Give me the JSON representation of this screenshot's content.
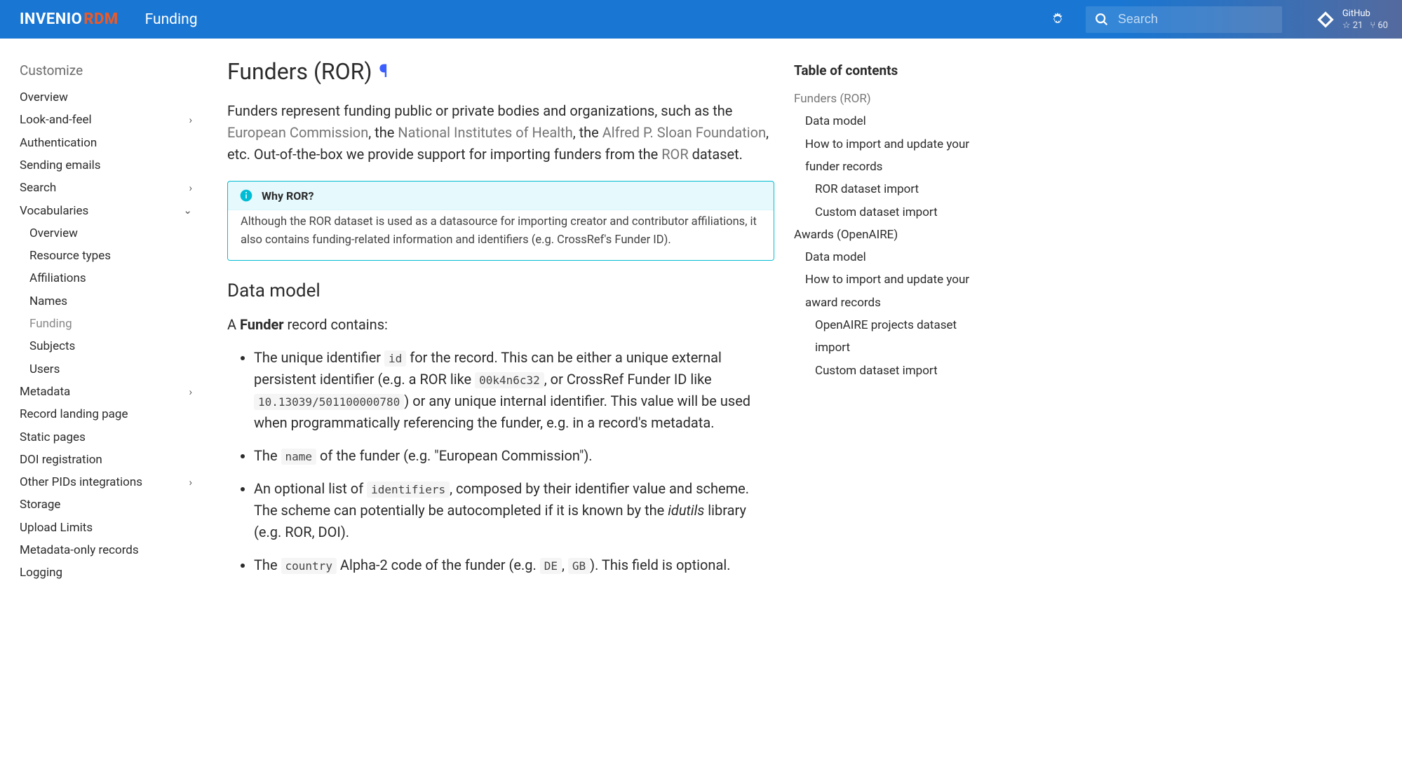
{
  "header": {
    "logo_invenio": "INVENIO",
    "logo_rdm": "RDM",
    "page_title": "Funding",
    "search_placeholder": "Search",
    "github_label": "GitHub",
    "github_stars": "21",
    "github_forks": "60"
  },
  "sidebar": {
    "section_title": "Customize",
    "items": [
      {
        "label": "Overview",
        "chev": false
      },
      {
        "label": "Look-and-feel",
        "chev": true
      },
      {
        "label": "Authentication",
        "chev": false
      },
      {
        "label": "Sending emails",
        "chev": false
      },
      {
        "label": "Search",
        "chev": true
      },
      {
        "label": "Vocabularies",
        "chev": true,
        "open": true
      },
      {
        "label": "Overview",
        "sub": true
      },
      {
        "label": "Resource types",
        "sub": true
      },
      {
        "label": "Affiliations",
        "sub": true
      },
      {
        "label": "Names",
        "sub": true
      },
      {
        "label": "Funding",
        "sub": true,
        "active": true
      },
      {
        "label": "Subjects",
        "sub": true
      },
      {
        "label": "Users",
        "sub": true
      },
      {
        "label": "Metadata",
        "chev": true
      },
      {
        "label": "Record landing page",
        "chev": false
      },
      {
        "label": "Static pages",
        "chev": false
      },
      {
        "label": "DOI registration",
        "chev": false
      },
      {
        "label": "Other PIDs integrations",
        "chev": true
      },
      {
        "label": "Storage",
        "chev": false
      },
      {
        "label": "Upload Limits",
        "chev": false
      },
      {
        "label": "Metadata-only records",
        "chev": false
      },
      {
        "label": "Logging",
        "chev": false
      }
    ]
  },
  "content": {
    "h1": "Funders (ROR)",
    "intro_1": "Funders represent funding public or private bodies and organizations, such as the ",
    "link_ec": "European Commission",
    "intro_2": ", the ",
    "link_nih": "National Institutes of Health",
    "intro_3": ", the ",
    "link_sloan": "Alfred P. Sloan Foundation",
    "intro_4": ", etc. Out-of-the-box we provide support for importing funders from the ",
    "link_ror": "ROR",
    "intro_5": " dataset.",
    "adm_title": "Why ROR?",
    "adm_body": "Although the ROR dataset is used as a datasource for importing creator and contributor affiliations, it also contains funding-related information and identifiers (e.g. CrossRef's Funder ID).",
    "h2": "Data model",
    "p_contains_1": "A ",
    "p_contains_bold": "Funder",
    "p_contains_2": " record contains:",
    "li1_a": "The unique identifier ",
    "li1_code1": "id",
    "li1_b": " for the record. This can be either a unique external persistent identifier (e.g. a ROR like ",
    "li1_code2": "00k4n6c32",
    "li1_c": ", or CrossRef Funder ID like ",
    "li1_code3": "10.13039/501100000780",
    "li1_d": ") or any unique internal identifier. This value will be used when programmatically referencing the funder, e.g. in a record's metadata.",
    "li2_a": "The ",
    "li2_code": "name",
    "li2_b": " of the funder (e.g. \"European Commission\").",
    "li3_a": "An optional list of ",
    "li3_code": "identifiers",
    "li3_b": ", composed by their identifier value and scheme. The scheme can potentially be autocompleted if it is known by the ",
    "li3_em": "idutils",
    "li3_c": " library (e.g. ROR, DOI).",
    "li4_a": "The ",
    "li4_code": "country",
    "li4_b": " Alpha-2 code of the funder (e.g. ",
    "li4_code2": "DE",
    "li4_c": ", ",
    "li4_code3": "GB",
    "li4_d": "). This field is optional."
  },
  "toc": {
    "title": "Table of contents",
    "items": [
      {
        "label": "Funders (ROR)",
        "level": 1
      },
      {
        "label": "Data model",
        "level": 2
      },
      {
        "label": "How to import and update your funder records",
        "level": 2
      },
      {
        "label": "ROR dataset import",
        "level": 3
      },
      {
        "label": "Custom dataset import",
        "level": 3
      },
      {
        "label": "Awards (OpenAIRE)",
        "level": 1,
        "dark": true
      },
      {
        "label": "Data model",
        "level": 2
      },
      {
        "label": "How to import and update your award records",
        "level": 2
      },
      {
        "label": "OpenAIRE projects dataset import",
        "level": 3
      },
      {
        "label": "Custom dataset import",
        "level": 3
      }
    ]
  }
}
